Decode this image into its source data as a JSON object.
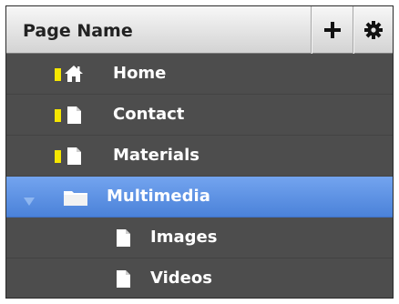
{
  "header": {
    "title": "Page Name"
  },
  "pages": [
    {
      "label": "Home",
      "icon": "home-icon"
    },
    {
      "label": "Contact",
      "icon": "page-icon"
    },
    {
      "label": "Materials",
      "icon": "page-icon"
    },
    {
      "label": "Multimedia",
      "icon": "folder-icon",
      "selected": true,
      "expanded": true
    },
    {
      "label": "Images",
      "icon": "page-icon"
    },
    {
      "label": "Videos",
      "icon": "page-icon"
    }
  ],
  "colors": {
    "panel_background": "#4d4d4d",
    "selection": "#5a8fe3",
    "marker": "#f5e600"
  }
}
